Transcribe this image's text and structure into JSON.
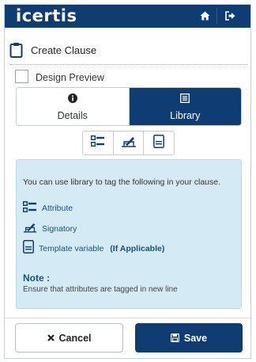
{
  "app": {
    "logo_text": "icertis"
  },
  "header": {
    "home_icon": "home-icon",
    "logout_icon": "sign-out-icon"
  },
  "page": {
    "title": "Create Clause",
    "title_icon": "clipboard-icon"
  },
  "design_preview": {
    "label": "Design Preview",
    "checked": false
  },
  "tabs": [
    {
      "label": "Details",
      "icon": "info-circle-icon",
      "active": false
    },
    {
      "label": "Library",
      "icon": "list-box-icon",
      "active": true
    }
  ],
  "toolbar": {
    "buttons": [
      "attribute-icon",
      "signatory-icon",
      "template-variable-icon"
    ]
  },
  "library": {
    "intro": "You can use library to tag the following in your clause.",
    "items": [
      {
        "label": "Attribute",
        "icon": "attribute-icon",
        "note": ""
      },
      {
        "label": "Signatory",
        "icon": "signatory-icon",
        "note": ""
      },
      {
        "label": "Template variable",
        "icon": "template-variable-icon",
        "note": "(If Applicable)"
      }
    ],
    "note_title": "Note :",
    "note_text": "Ensure that attributes are tagged in new line"
  },
  "footer": {
    "cancel_label": "Cancel",
    "save_label": "Save"
  },
  "colors": {
    "primary": "#0f3c73",
    "panel_bg": "#d4eaf4",
    "link": "#1b4f80"
  }
}
